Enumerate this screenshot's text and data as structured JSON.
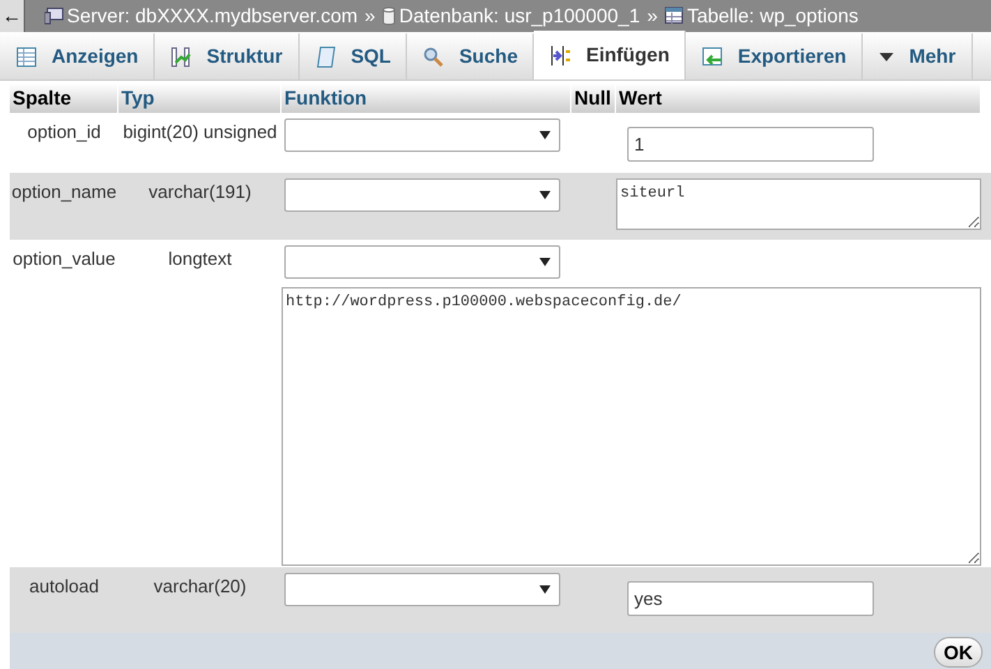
{
  "breadcrumb": [
    {
      "kind": "server",
      "label": "Server: dbXXXX.mydbserver.com"
    },
    {
      "kind": "database",
      "label": "Datenbank: usr_p100000_1"
    },
    {
      "kind": "table",
      "label": "Tabelle: wp_options"
    }
  ],
  "separator": "»",
  "back": "←",
  "tabs": [
    {
      "kind": "browse",
      "label": "Anzeigen",
      "selected": false
    },
    {
      "kind": "structure",
      "label": "Struktur",
      "selected": false
    },
    {
      "kind": "sql",
      "label": "SQL",
      "selected": false
    },
    {
      "kind": "search",
      "label": "Suche",
      "selected": false
    },
    {
      "kind": "insert",
      "label": "Einfügen",
      "selected": true
    },
    {
      "kind": "export",
      "label": "Exportieren",
      "selected": false
    },
    {
      "kind": "more",
      "label": "Mehr",
      "selected": false
    }
  ],
  "table": {
    "columns": [
      "Spalte",
      "Typ",
      "Funktion",
      "Null",
      "Wert"
    ],
    "rows": [
      {
        "column": "option_id",
        "type": "bigint(20) unsigned",
        "value": {
          "kind": "input",
          "text": "1"
        }
      },
      {
        "column": "option_name",
        "type": "varchar(191)",
        "value": {
          "kind": "textarea",
          "text": "siteurl"
        }
      },
      {
        "column": "option_value",
        "type": "longtext",
        "value": {
          "kind": "bigtextarea",
          "text": "http://wordpress.p100000.webspaceconfig.de/"
        }
      },
      {
        "column": "autoload",
        "type": "varchar(20)",
        "value": {
          "kind": "input",
          "text": "yes"
        }
      }
    ]
  },
  "ok_button": "OK"
}
